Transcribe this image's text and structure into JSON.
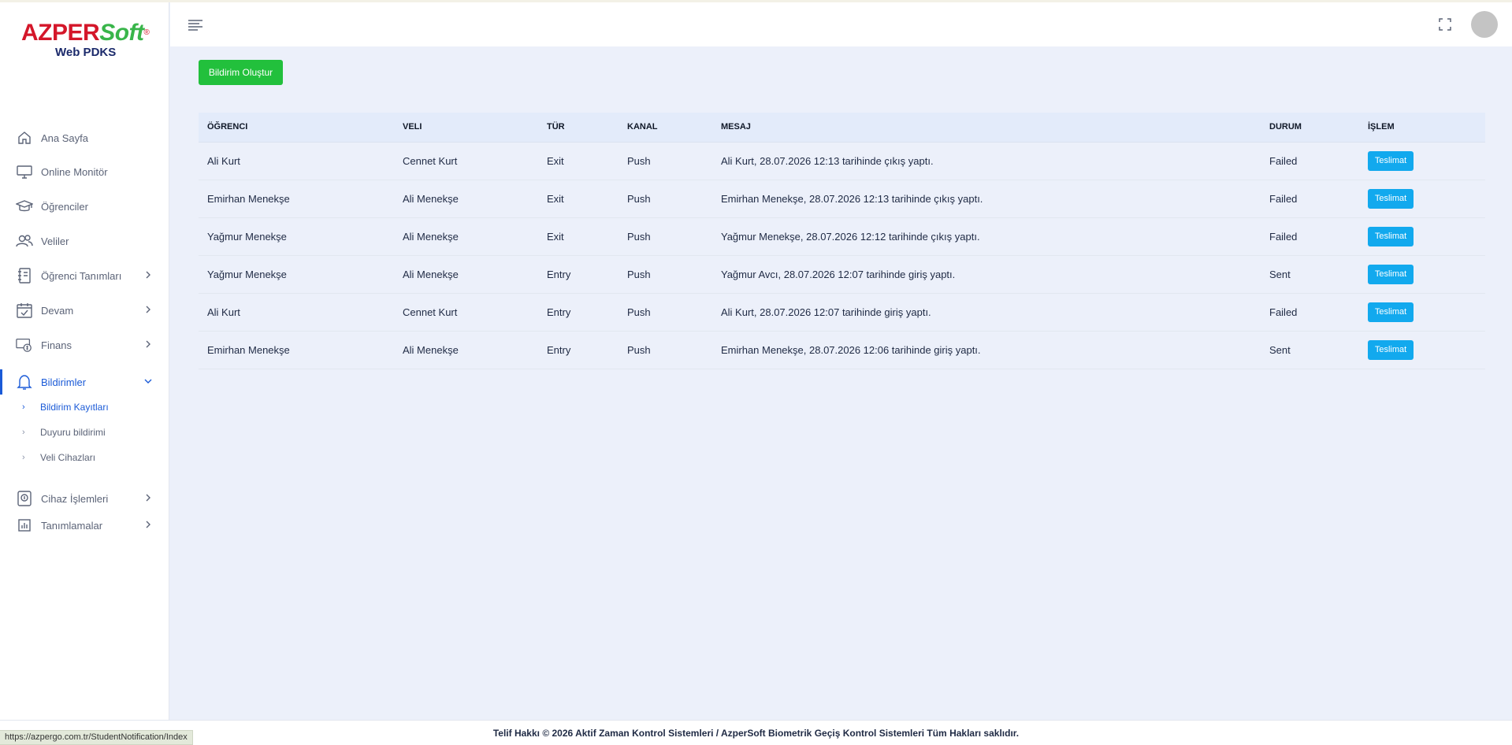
{
  "brand": {
    "logo_primary": "AZPER",
    "logo_secondary": "Soft",
    "logo_registered": "®",
    "logo_subtitle": "Web PDKS",
    "colors": {
      "red": "#d4172a",
      "green": "#39b54a",
      "navy": "#1b2a6b"
    }
  },
  "sidebar": {
    "items": [
      {
        "label": "Ana Sayfa",
        "icon": "home-icon"
      },
      {
        "label": "Online Monitör",
        "icon": "monitor-icon"
      },
      {
        "label": "Öğrenciler",
        "icon": "graduation-cap-icon"
      },
      {
        "label": "Veliler",
        "icon": "users-icon"
      },
      {
        "label": "Öğrenci Tanımları",
        "icon": "notebook-icon"
      },
      {
        "label": "Devam",
        "icon": "calendar-check-icon"
      },
      {
        "label": "Finans",
        "icon": "money-icon"
      },
      {
        "label": "Bildirimler",
        "icon": "bell-icon"
      },
      {
        "label": "Cihaz İşlemleri",
        "icon": "device-icon"
      },
      {
        "label": "Tanımlamalar",
        "icon": "chart-icon"
      }
    ],
    "sub_items": [
      {
        "label": "Bildirim Kayıtları"
      },
      {
        "label": "Duyuru bildirimi"
      },
      {
        "label": "Veli Cihazları"
      }
    ]
  },
  "toolbar": {
    "create_label": "Bildirim Oluştur"
  },
  "table": {
    "headers": [
      "ÖĞRENCI",
      "VELI",
      "TÜR",
      "KANAL",
      "MESAJ",
      "DURUM",
      "İŞLEM"
    ],
    "action_label": "Teslimat",
    "rows": [
      {
        "student": "Ali Kurt",
        "parent": "Cennet Kurt",
        "type": "Exit",
        "channel": "Push",
        "message": "Ali Kurt, 28.07.2026 12:13 tarihinde çıkış yaptı.",
        "status": "Failed"
      },
      {
        "student": "Emirhan Menekşe",
        "parent": "Ali Menekşe",
        "type": "Exit",
        "channel": "Push",
        "message": "Emirhan Menekşe, 28.07.2026 12:13 tarihinde çıkış yaptı.",
        "status": "Failed"
      },
      {
        "student": "Yağmur Menekşe",
        "parent": "Ali Menekşe",
        "type": "Exit",
        "channel": "Push",
        "message": "Yağmur Menekşe, 28.07.2026 12:12 tarihinde çıkış yaptı.",
        "status": "Failed"
      },
      {
        "student": "Yağmur Menekşe",
        "parent": "Ali Menekşe",
        "type": "Entry",
        "channel": "Push",
        "message": "Yağmur Avcı, 28.07.2026 12:07 tarihinde giriş yaptı.",
        "status": "Sent"
      },
      {
        "student": "Ali Kurt",
        "parent": "Cennet Kurt",
        "type": "Entry",
        "channel": "Push",
        "message": "Ali Kurt, 28.07.2026 12:07 tarihinde giriş yaptı.",
        "status": "Failed"
      },
      {
        "student": "Emirhan Menekşe",
        "parent": "Ali Menekşe",
        "type": "Entry",
        "channel": "Push",
        "message": "Emirhan Menekşe, 28.07.2026 12:06 tarihinde giriş yaptı.",
        "status": "Sent"
      }
    ]
  },
  "footer": {
    "copyright": "Telif Hakkı © 2026 Aktif Zaman Kontrol Sistemleri / AzperSoft Biometrik Geçiş Kontrol Sistemleri Tüm Hakları saklıdır."
  },
  "status_bar": {
    "url": "https://azpergo.com.tr/StudentNotification/Index"
  },
  "colors": {
    "accent": "#1a5ad7",
    "create_button": "#22c03c",
    "action_button": "#12a9ee",
    "background": "#ecf0fa"
  }
}
